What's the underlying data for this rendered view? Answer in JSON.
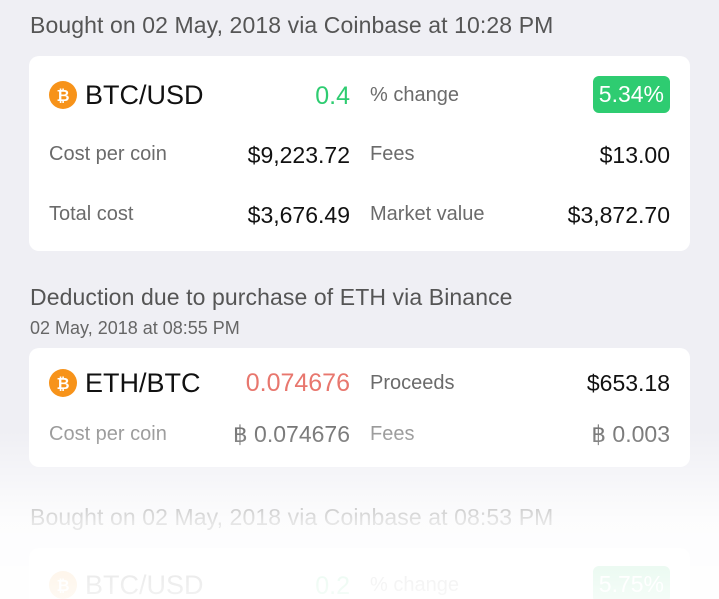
{
  "transactions": [
    {
      "title": "Bought on 02 May, 2018 via Coinbase at 10:28 PM",
      "pair": "BTC/USD",
      "amount": "0.4",
      "change_label": "% change",
      "change_value": "5.34%",
      "cost_label": "Cost per coin",
      "cost_value": "$9,223.72",
      "fees_label": "Fees",
      "fees_value": "$13.00",
      "total_label": "Total cost",
      "total_value": "$3,676.49",
      "market_label": "Market value",
      "market_value": "$3,872.70",
      "icon": "bitcoin-icon"
    },
    {
      "title": "Deduction due to purchase of ETH via Binance",
      "subtitle": "02 May, 2018 at 08:55 PM",
      "pair": "ETH/BTC",
      "amount": "0.074676",
      "proceeds_label": "Proceeds",
      "proceeds_value": "$653.18",
      "cost_label": "Cost per coin",
      "cost_value": "฿ 0.074676",
      "fees_label": "Fees",
      "fees_value": "฿ 0.003",
      "icon": "bitcoin-icon"
    },
    {
      "title": "Bought on 02 May, 2018 via Coinbase at 08:53 PM",
      "pair": "BTC/USD",
      "amount": "0.2",
      "change_label": "% change",
      "change_value": "5.75%",
      "icon": "bitcoin-icon"
    }
  ],
  "colors": {
    "positive": "#2ecc71",
    "negative": "#e8776e",
    "coin": "#f7931a",
    "background": "#efeff4"
  }
}
